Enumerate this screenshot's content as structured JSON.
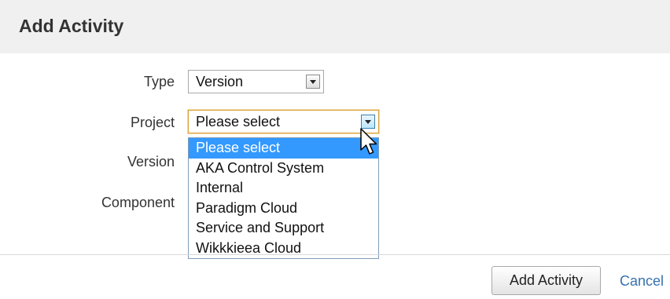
{
  "header": {
    "title": "Add Activity"
  },
  "form": {
    "type": {
      "label": "Type",
      "value": "Version"
    },
    "project": {
      "label": "Project",
      "value": "Please select"
    },
    "version": {
      "label": "Version"
    },
    "component": {
      "label": "Component"
    }
  },
  "project_dropdown": {
    "options": [
      "Please select",
      "AKA Control System",
      "Internal",
      "Paradigm Cloud",
      "Service and Support",
      "Wikkkieea Cloud"
    ],
    "selected_index": 0
  },
  "footer": {
    "add_label": "Add Activity",
    "cancel_label": "Cancel"
  },
  "colors": {
    "header_bg": "#f0f0f0",
    "selection_bg": "#3399ff",
    "link": "#3572b0",
    "focus_border": "#d9a038"
  }
}
